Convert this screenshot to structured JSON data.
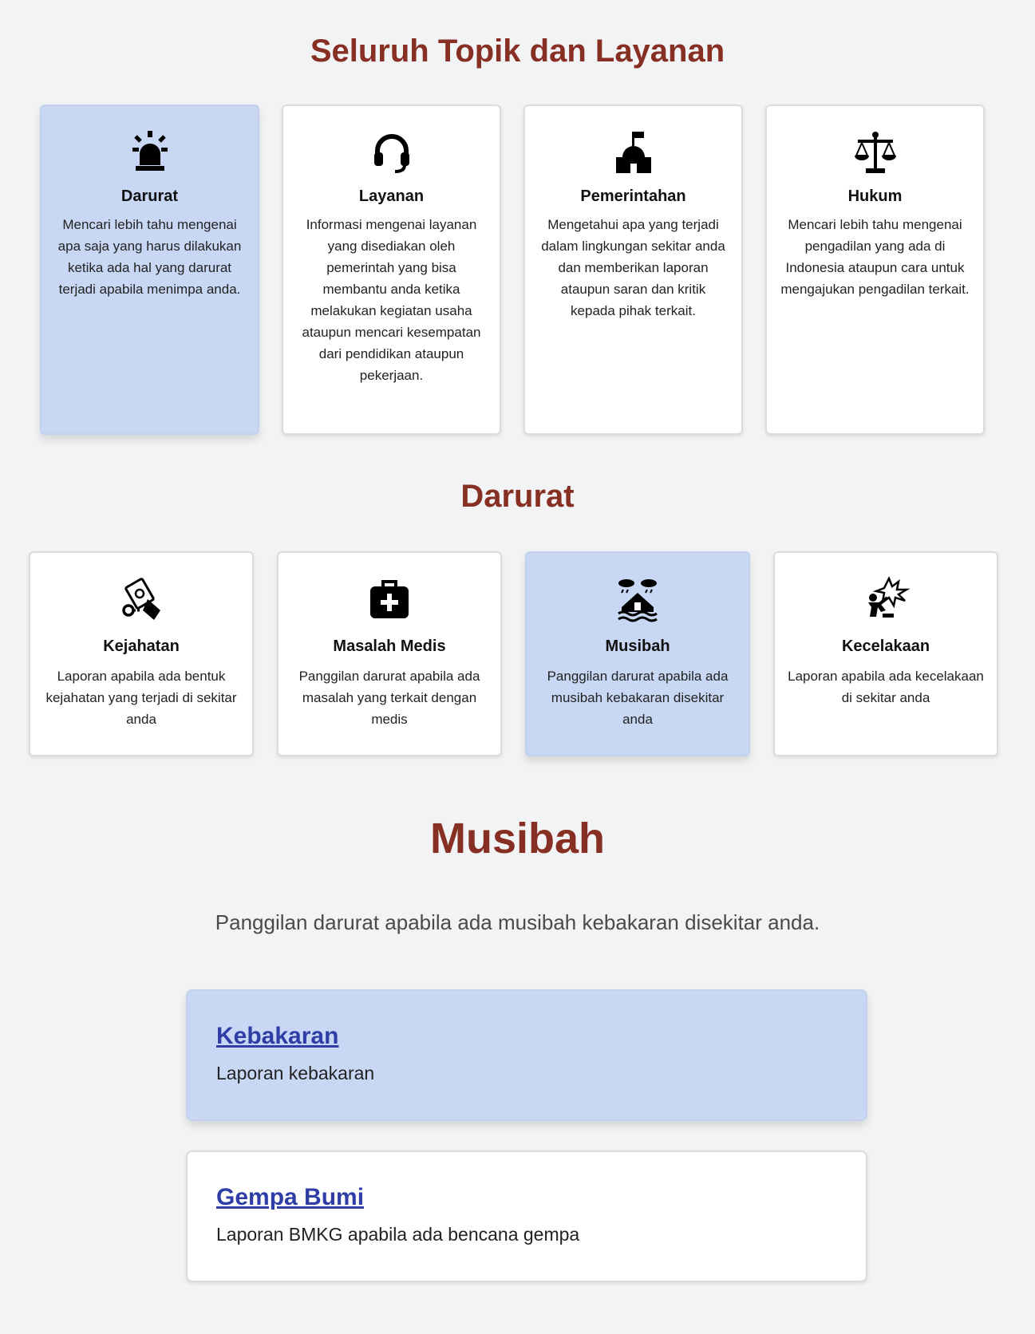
{
  "sections": {
    "topics_title": "Seluruh Topik dan Layanan",
    "darurat_title": "Darurat",
    "musibah_title": "Musibah",
    "musibah_subtitle": "Panggilan darurat apabila ada musibah kebakaran disekitar anda."
  },
  "topics": [
    {
      "title": "Darurat",
      "desc": "Mencari lebih tahu mengenai apa saja yang harus dilakukan ketika ada hal yang darurat terjadi apabila menimpa anda.",
      "icon": "siren-icon"
    },
    {
      "title": "Layanan",
      "desc": "Informasi mengenai layanan yang disediakan oleh pemerintah yang bisa membantu anda ketika melakukan kegiatan usaha ataupun mencari kesempatan dari pendidikan ataupun pekerjaan.",
      "icon": "headset-icon"
    },
    {
      "title": "Pemerintahan",
      "desc": "Mengetahui apa yang terjadi dalam lingkungan sekitar anda dan memberikan laporan ataupun saran dan kritik kepada pihak terkait.",
      "icon": "government-building-icon"
    },
    {
      "title": "Hukum",
      "desc": "Mencari lebih tahu mengenai pengadilan yang ada di Indonesia ataupun cara untuk mengajukan pengadilan terkait.",
      "icon": "scales-icon"
    }
  ],
  "darurat": [
    {
      "title": "Kejahatan",
      "desc": "Laporan apabila ada bentuk kejahatan yang terjadi di sekitar anda",
      "icon": "handcuffed-money-icon"
    },
    {
      "title": "Masalah Medis",
      "desc": "Panggilan darurat apabila ada masalah yang terkait dengan medis",
      "icon": "medical-kit-icon"
    },
    {
      "title": "Musibah",
      "desc": "Panggilan darurat apabila ada musibah kebakaran disekitar anda",
      "icon": "house-flood-icon"
    },
    {
      "title": "Kecelakaan",
      "desc": "Laporan apabila ada kecelakaan di sekitar anda",
      "icon": "person-burst-icon"
    }
  ],
  "musibah_items": [
    {
      "title": "Kebakaran",
      "desc": "Laporan kebakaran"
    },
    {
      "title": "Gempa Bumi",
      "desc": "Laporan BMKG apabila ada bencana gempa"
    }
  ],
  "colors": {
    "heading": "#862f22",
    "active_card": "#c8d8f4",
    "link": "#2f3ea6",
    "background": "#f2f3f5"
  }
}
